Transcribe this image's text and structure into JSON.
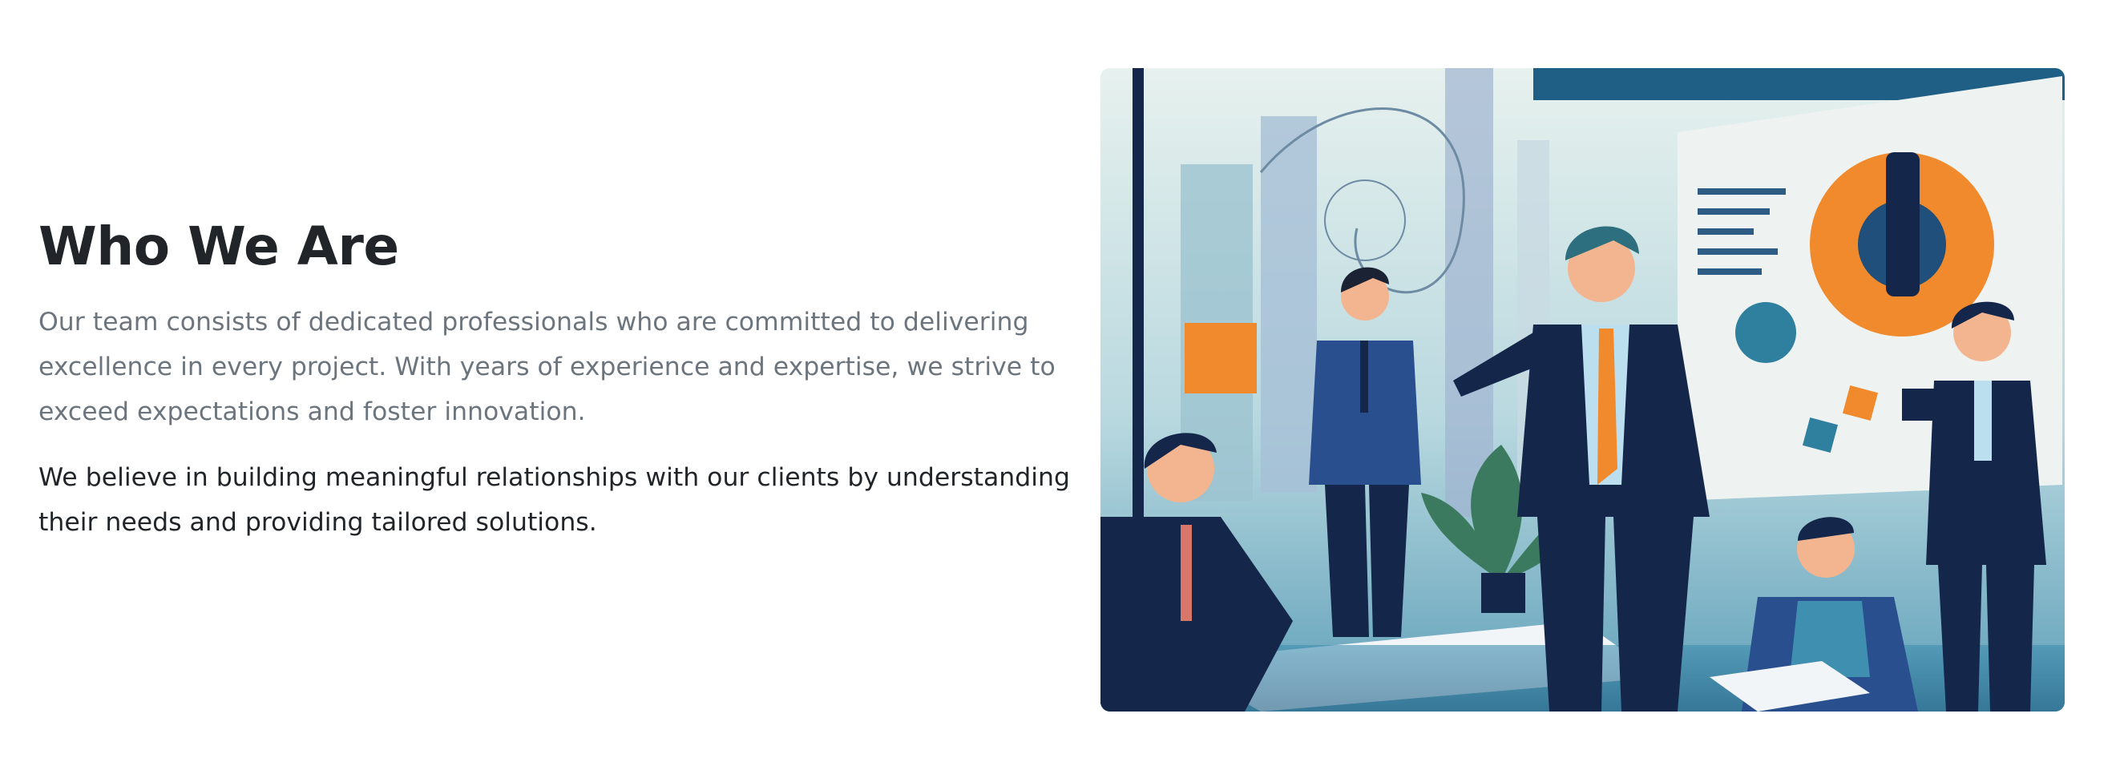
{
  "about": {
    "title": "Who We Are",
    "lead": "Our team consists of dedicated professionals who are committed to delivering excellence in every project. With years of experience and expertise, we strive to exceed expectations and foster innovation.",
    "body": "We believe in building meaningful relationships with our clients by understanding their needs and providing tailored solutions."
  },
  "colors": {
    "heading": "#212529",
    "muted_text": "#6c757d",
    "accent_orange": "#f08a2c",
    "navy": "#14264a",
    "teal": "#2f7f9e"
  },
  "illustration": {
    "subject": "business-team-meeting-illustration"
  }
}
